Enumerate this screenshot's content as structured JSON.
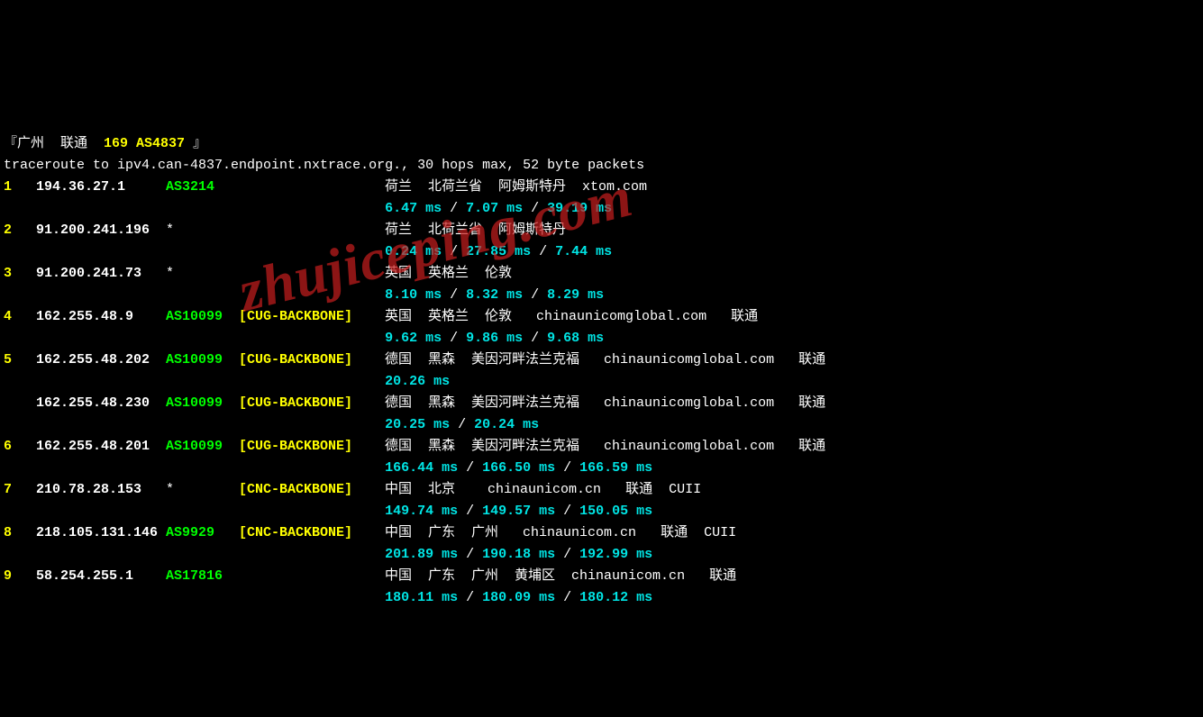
{
  "header": {
    "open": "『",
    "loc": "广州",
    "isp": "联通",
    "asn": "169 AS4837",
    "close": "』"
  },
  "cmd": "traceroute to ipv4.can-4837.endpoint.nxtrace.org., 30 hops max, 52 byte packets",
  "watermark": "zhujiceping.com",
  "sep": " / ",
  "hops": [
    {
      "n": "1",
      "ip": "194.36.27.1",
      "asn": "AS3214",
      "bb": "",
      "loc": "荷兰  北荷兰省  阿姆斯特丹  xtom.com",
      "lat": [
        "6.47 ms",
        "7.07 ms",
        "39.19 ms"
      ]
    },
    {
      "n": "2",
      "ip": "91.200.241.196",
      "asn": "*",
      "bb": "",
      "loc": "荷兰  北荷兰省  阿姆斯特丹",
      "lat": [
        "0.24 ms",
        "27.85 ms",
        "7.44 ms"
      ]
    },
    {
      "n": "3",
      "ip": "91.200.241.73",
      "asn": "*",
      "bb": "",
      "loc": "英国  英格兰  伦敦",
      "lat": [
        "8.10 ms",
        "8.32 ms",
        "8.29 ms"
      ]
    },
    {
      "n": "4",
      "ip": "162.255.48.9",
      "asn": "AS10099",
      "bb": "[CUG-BACKBONE]",
      "loc": "英国  英格兰  伦敦   chinaunicomglobal.com   联通",
      "lat": [
        "9.62 ms",
        "9.86 ms",
        "9.68 ms"
      ]
    },
    {
      "n": "5",
      "ip": "162.255.48.202",
      "asn": "AS10099",
      "bb": "[CUG-BACKBONE]",
      "loc": "德国  黑森  美因河畔法兰克福   chinaunicomglobal.com   联通",
      "lat": [
        "20.26 ms"
      ]
    },
    {
      "n": "",
      "ip": "162.255.48.230",
      "asn": "AS10099",
      "bb": "[CUG-BACKBONE]",
      "loc": "德国  黑森  美因河畔法兰克福   chinaunicomglobal.com   联通",
      "lat": [
        "20.25 ms",
        "20.24 ms"
      ]
    },
    {
      "n": "6",
      "ip": "162.255.48.201",
      "asn": "AS10099",
      "bb": "[CUG-BACKBONE]",
      "loc": "德国  黑森  美因河畔法兰克福   chinaunicomglobal.com   联通",
      "lat": [
        "166.44 ms",
        "166.50 ms",
        "166.59 ms"
      ]
    },
    {
      "n": "7",
      "ip": "210.78.28.153",
      "asn": "*",
      "bb": "[CNC-BACKBONE]",
      "loc": "中国  北京    chinaunicom.cn   联通  CUII",
      "lat": [
        "149.74 ms",
        "149.57 ms",
        "150.05 ms"
      ]
    },
    {
      "n": "8",
      "ip": "218.105.131.146",
      "asn": "AS9929",
      "bb": "[CNC-BACKBONE]",
      "loc": "中国  广东  广州   chinaunicom.cn   联通  CUII",
      "lat": [
        "201.89 ms",
        "190.18 ms",
        "192.99 ms"
      ]
    },
    {
      "n": "9",
      "ip": "58.254.255.1",
      "asn": "AS17816",
      "bb": "",
      "loc": "中国  广东  广州  黄埔区  chinaunicom.cn   联通",
      "lat": [
        "180.11 ms",
        "180.09 ms",
        "180.12 ms"
      ]
    }
  ]
}
